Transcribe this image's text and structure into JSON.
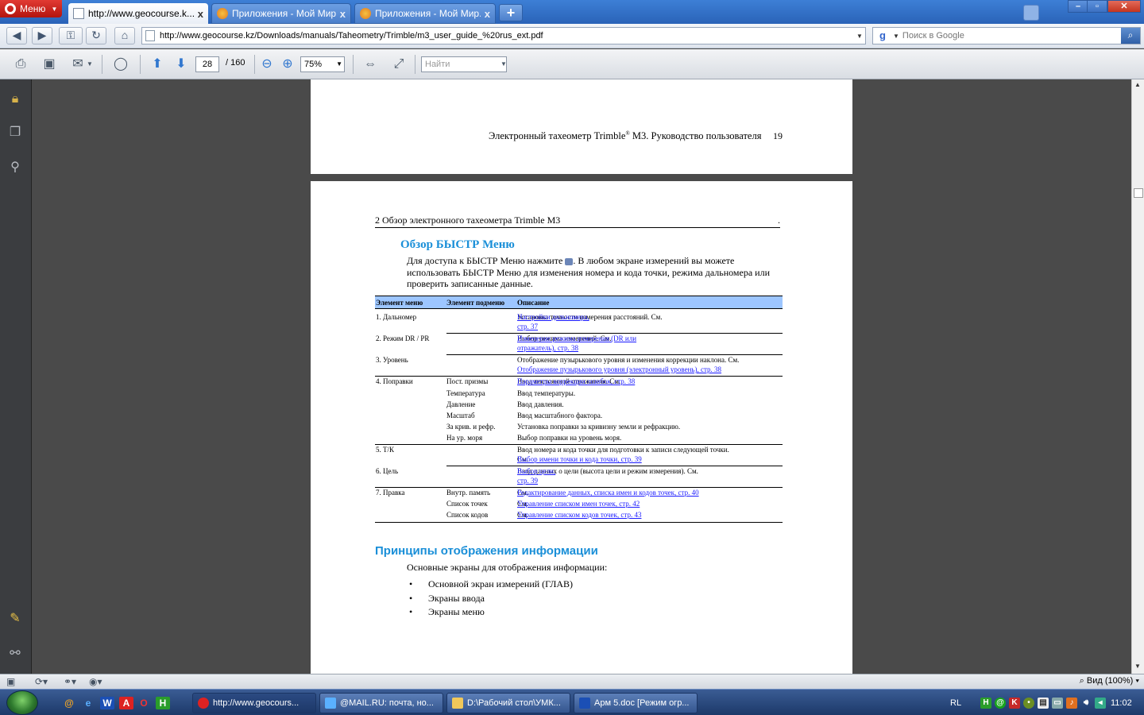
{
  "tabbar": {
    "menu_label": "Меню",
    "tabs": [
      {
        "label": "http://www.geocourse.k...",
        "active": true
      },
      {
        "label": "Приложения - Мой Мир...",
        "active": false
      },
      {
        "label": "Приложения - Мой Мир...",
        "active": false
      }
    ],
    "new_tab": "+",
    "close": "x"
  },
  "nav": {
    "url": "http://www.geocourse.kz/Downloads/manuals/Taheometry/Trimble/m3_user_guide_%20rus_ext.pdf",
    "search_placeholder": "Поиск в Google"
  },
  "pdf_toolbar": {
    "page_current": "28",
    "page_total": "/ 160",
    "zoom": "75%",
    "find_placeholder": "Найти"
  },
  "document": {
    "page1": {
      "running_head_pre": "Электронный тахеометр Trimble",
      "running_head_sup": "®",
      "running_head_post": " M3. Руководство пользователя",
      "page_number": "19"
    },
    "page2": {
      "chapter_head": "2  Обзор электронного тахеометра Trimble M3",
      "chapter_head_tail": ".",
      "section1_title": "Обзор БЫСТР Меню",
      "section1_para_a": "Для доступа к БЫСТР Меню нажмите ",
      "section1_para_b": ". В любом экране измерений вы можете использовать БЫСТР Меню для изменения номера и кода точки, режима дальномера или проверить записанные данные.",
      "table_headers": [
        "Элемент меню",
        "Элемент подменю",
        "Описание"
      ],
      "table": {
        "r1c1": "1. Дальномер",
        "r1c3a": "Установка точности измерения расстояний. См. ",
        "r1c3link": "Настройки дальномера,",
        "r1c3link2": "стр. 37",
        "r2c1": "2. Режим DR / PR",
        "r2c3a": "Выбор режима измерений. См. ",
        "r2c3link": "Изменение режима измерения (DR или",
        "r2c3link2": "отражатель), стр. 38",
        "r3c1": "3. Уровень",
        "r3c3a": "Отображение пузырькового уровня и изменения коррекции наклона. См.",
        "r3c3link": "Отображение пузырькового уровня (электронный уровень), стр. 38",
        "r4c1": "4. Поправки",
        "r4s1": "Пост. призмы",
        "r4d1a": "Ввод постоянной отражателя. См.",
        "r4d1link": "Параметры коррекции ошибок, стр. 38",
        "r4s2": "Температура",
        "r4d2": "Ввод температуры.",
        "r4s3": "Давление",
        "r4d3": "Ввод давления.",
        "r4s4": "Масштаб",
        "r4d4": "Ввод масштабного фактора.",
        "r4s5": "За крив. и рефр.",
        "r4d5": "Установка поправки за кривизну земли и рефракцию.",
        "r4s6": "На ур. моря",
        "r4d6": "Выбор поправки на уровень моря.",
        "r5c1": "5. Т/К",
        "r5c3a": "Ввод номера и кода точки для подготовки к записи следующей точки.",
        "r5c3b": "См.",
        "r5c3link": "Выбор имени точки и кода точки, стр. 39",
        "r6c1": "6. Цель",
        "r6c3a": "Ввод данных о цели (высота цели и режим измерения). См.",
        "r6c3link": " Выбор цели,",
        "r6c3link2": "стр. 39",
        "r7c1": "7. Правка",
        "r7s1": "Внутр. память",
        "r7d1a": "См. ",
        "r7d1link": "Редактирование данных, списка имен и кодов точек, стр. 40",
        "r7s2": "Список точек",
        "r7d2a": "См. ",
        "r7d2link": "Управление списком имен точек, стр. 42",
        "r7s3": "Список кодов",
        "r7d3a": "См. ",
        "r7d3link": "Управление списком кодов точек, стр. 43"
      },
      "section2_title": "Принципы отображения информации",
      "section2_para": "Основные экраны для отображения информации:",
      "bullets": [
        "Основной экран измерений (ГЛАВ)",
        "Экраны ввода",
        "Экраны меню"
      ],
      "bullet_char": "•"
    }
  },
  "statusbar": {
    "zoom": "Вид (100%)"
  },
  "taskbar": {
    "tasks": [
      "http://www.geocours...",
      "@MAIL.RU: почта, но...",
      "D:\\Рабочий стол\\УМК...",
      "Арм 5.doc [Режим огр..."
    ],
    "lang": "RL",
    "clock": "11:02"
  }
}
